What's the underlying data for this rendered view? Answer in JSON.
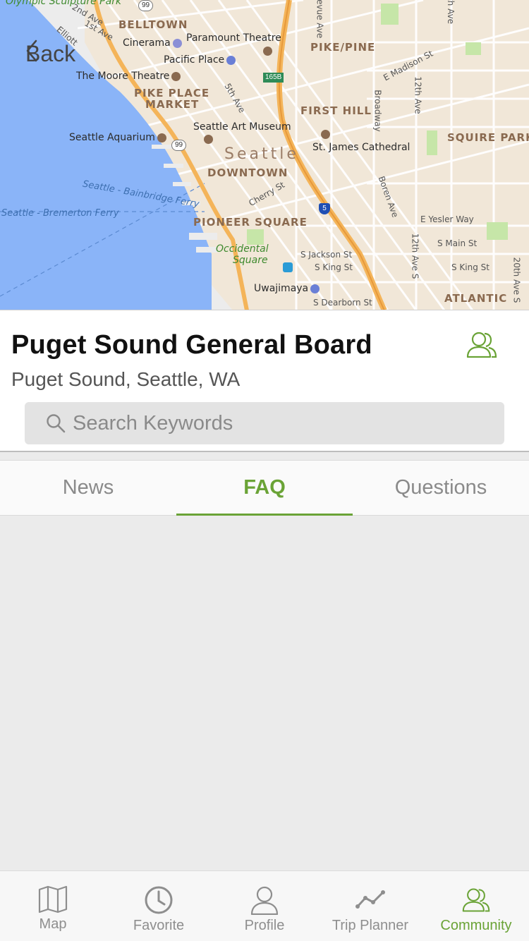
{
  "map": {
    "labels": {
      "sculpture_park": "Olympic Sculpture Park",
      "belltown": "BELLTOWN",
      "cinerama": "Cinerama",
      "paramount": "Paramount Theatre",
      "pacific_place": "Pacific Place",
      "moore": "The Moore Theatre",
      "pike_place": "PIKE PLACE",
      "market": "MARKET",
      "pike_pine": "PIKE/PINE",
      "first_hill": "FIRST HILL",
      "art_museum": "Seattle Art Museum",
      "aquarium": "Seattle Aquarium",
      "seattle": "Seattle",
      "downtown": "DOWNTOWN",
      "st_james": "St. James Cathedral",
      "squire_park": "SQUIRE PARK",
      "ferry_bainbridge": "Seattle - Bainbridge Ferry",
      "ferry_bremerton": "Seattle - Bremerton Ferry",
      "pioneer_square": "PIONEER SQUARE",
      "occidental": "Occidental",
      "square": "Square",
      "uwajimaya": "Uwajimaya",
      "atlantic": "ATLANTIC",
      "e_madison": "E Madison St",
      "e_yesler": "E Yesler Way",
      "s_main": "S Main St",
      "s_jackson": "S Jackson St",
      "s_king": "S King St",
      "s_king2": "S King St",
      "s_dearborn": "S Dearborn St",
      "cherry": "Cherry St",
      "boren": "Boren Ave",
      "broadway": "Broadway",
      "twelfth_ave": "12th Ave",
      "twelfth_ave_s": "12th Ave S",
      "fifth_ave": "5th Ave",
      "first_ave": "1st Ave",
      "second_ave": "2nd Ave",
      "elliott": "Elliott",
      "bellevue_ave": "levue Ave",
      "twentieth_ave": "20th Ave S",
      "th_ave": "th Ave",
      "hw99": "99",
      "hw99b": "99",
      "hw165": "165B",
      "i5": "5"
    }
  },
  "back_label": "Back",
  "board": {
    "title": "Puget Sound General Board",
    "location": "Puget Sound, Seattle, WA"
  },
  "search": {
    "placeholder": "Search Keywords"
  },
  "tabs": [
    {
      "label": "News",
      "active": false
    },
    {
      "label": "FAQ",
      "active": true
    },
    {
      "label": "Questions",
      "active": false
    }
  ],
  "tabbar": [
    {
      "label": "Map",
      "icon": "map-icon"
    },
    {
      "label": "Favorite",
      "icon": "clock-icon"
    },
    {
      "label": "Profile",
      "icon": "person-icon"
    },
    {
      "label": "Trip Planner",
      "icon": "route-icon"
    },
    {
      "label": "Community",
      "icon": "community-icon",
      "active": true
    }
  ],
  "colors": {
    "accent": "#6aa336",
    "water": "#8ab4f8",
    "land": "#ececec",
    "urban": "#f5e3c8",
    "highway": "#f4b459"
  }
}
